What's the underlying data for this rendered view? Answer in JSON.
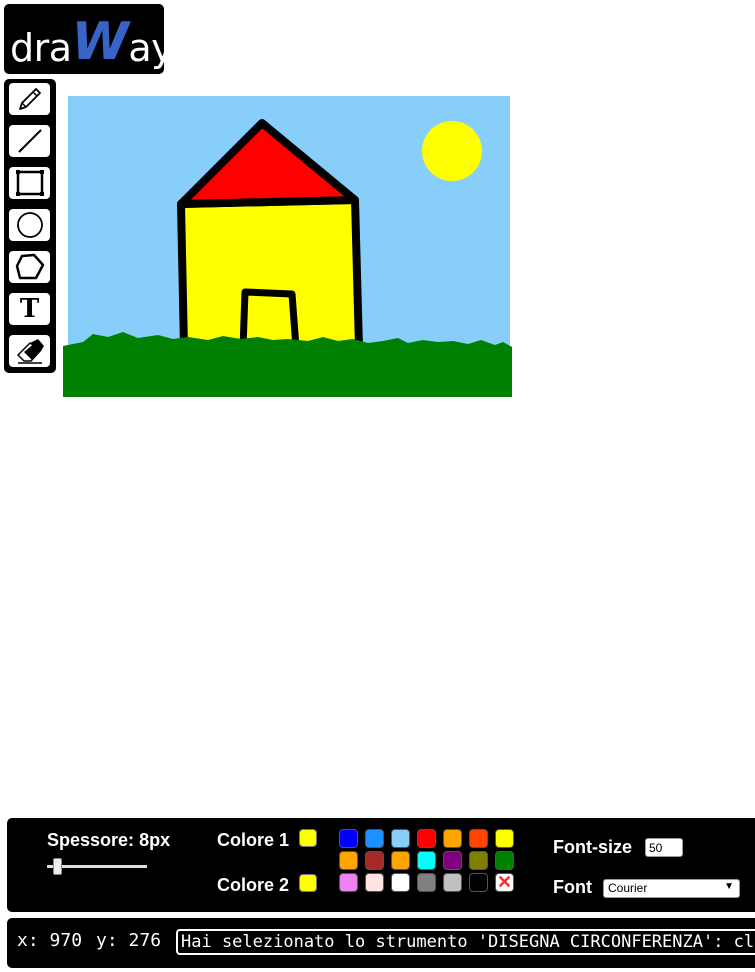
{
  "app": {
    "logo_prefix": "dra",
    "logo_mark": "W",
    "logo_suffix": "ay"
  },
  "tools": [
    {
      "name": "pencil-icon",
      "label": ""
    },
    {
      "name": "line-icon",
      "label": ""
    },
    {
      "name": "rectangle-icon",
      "label": ""
    },
    {
      "name": "circle-icon",
      "label": ""
    },
    {
      "name": "polygon-icon",
      "label": ""
    },
    {
      "name": "text-icon",
      "label": "T"
    },
    {
      "name": "eraser-icon",
      "label": ""
    }
  ],
  "canvas": {
    "sky_color": "#87CEFA",
    "grass_color": "#008000",
    "wall_color": "#FFFF00",
    "roof_color": "#FF0000",
    "sun_color": "#FFFF00",
    "outline_color": "#000000"
  },
  "controls": {
    "thickness_label": "Spessore:",
    "thickness_value": "8px",
    "thickness_slider_fraction": 0.08,
    "color1_label": "Colore 1",
    "color1_value": "#FFFF00",
    "color2_label": "Colore 2",
    "color2_value": "#FFFF00",
    "palette": [
      "#0000FF",
      "#1E90FF",
      "#87CEFA",
      "#FF0000",
      "#FFA500",
      "#FF4500",
      "#FFFF00",
      "#FFA500",
      "#A52A2A",
      "#FFA500",
      "#00FFFF",
      "#800080",
      "#808000",
      "#008000",
      "#EE82EE",
      "#FFE4E1",
      "#FFFFFF",
      "#808080",
      "#C0C0C0",
      "#000000",
      "none"
    ],
    "no_color_symbol": "✕",
    "font_size_label": "Font-size",
    "font_size_value": "50",
    "font_label": "Font",
    "font_value": "Courier",
    "font_arrow": "▼"
  },
  "status": {
    "x_label": "x:",
    "x_value": "970",
    "y_label": "y:",
    "y_value": "276",
    "message": "Hai selezionato lo strumento 'DISEGNA CIRCONFERENZA': clicca e trascina per disegnare"
  }
}
